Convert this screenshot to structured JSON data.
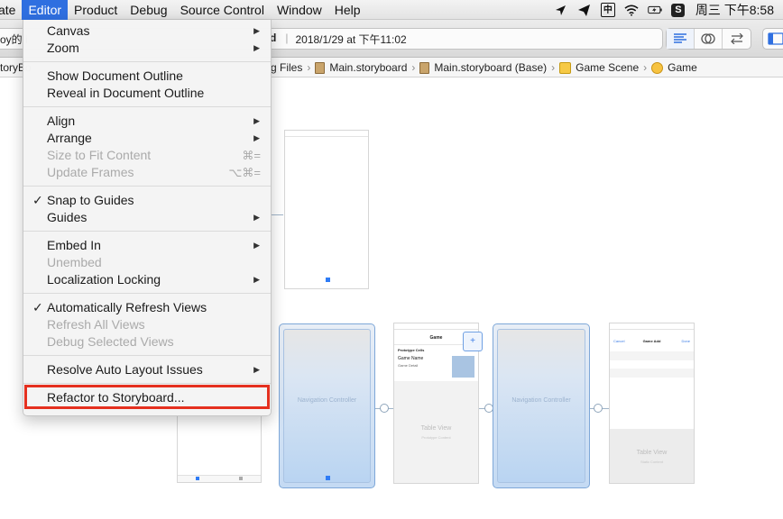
{
  "menubar": {
    "items": [
      "ate",
      "Editor",
      "Product",
      "Debug",
      "Source Control",
      "Window",
      "Help"
    ],
    "active": "Editor",
    "clock": "周三 下午8:58",
    "status_icons": [
      "navigation-icon",
      "send-icon",
      "input-method-icon",
      "wifi-icon",
      "battery-icon",
      "app-s-icon"
    ],
    "input_method_label": "中",
    "app_badge": "S"
  },
  "toolbar": {
    "activity_left": "oy的 i",
    "activity_bold": "d",
    "activity_time": "2018/1/29 at 下午11:02"
  },
  "jumpbar": {
    "left_crumb": "toryBo",
    "crumbs": [
      "g Files",
      "Main.storyboard",
      "Main.storyboard (Base)",
      "Game Scene",
      "Game"
    ]
  },
  "editor_menu": {
    "canvas": "Canvas",
    "zoom": "Zoom",
    "show_outline": "Show Document Outline",
    "reveal_outline": "Reveal in Document Outline",
    "align": "Align",
    "arrange": "Arrange",
    "size_to_fit": "Size to Fit Content",
    "size_to_fit_kbd": "⌘=",
    "update_frames": "Update Frames",
    "update_frames_kbd": "⌥⌘=",
    "snap_to_guides": "Snap to Guides",
    "guides": "Guides",
    "embed_in": "Embed In",
    "unembed": "Unembed",
    "localization_locking": "Localization Locking",
    "auto_refresh": "Automatically Refresh Views",
    "refresh_all": "Refresh All Views",
    "debug_selected": "Debug Selected Views",
    "resolve_auto_layout": "Resolve Auto Layout Issues",
    "refactor": "Refactor to Storyboard..."
  },
  "canvas": {
    "nav_controller_label": "Navigation Controller",
    "game_title": "Game",
    "prototype_cells": "Prototype Cells",
    "game_name": "Game Name",
    "game_detail": "Game Detail",
    "table_view": "Table View",
    "prototype_content": "Prototype Content",
    "static_content": "Static Content",
    "game_add_title": "Game Add",
    "cancel": "Cancel",
    "done": "Done"
  },
  "colors": {
    "menu_highlight": "#2f6fe0",
    "annotation_box": "#e5301f",
    "nav_blue": "#c4daf3"
  }
}
